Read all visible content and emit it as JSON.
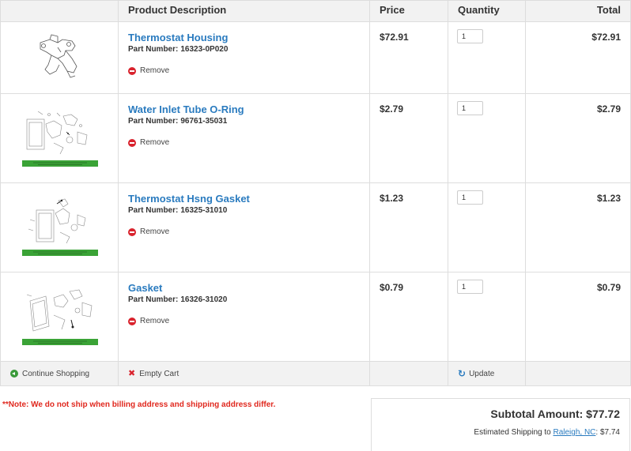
{
  "table": {
    "headers": {
      "image": "",
      "description": "Product Description",
      "price": "Price",
      "quantity": "Quantity",
      "total": "Total"
    },
    "part_label": "Part Number:",
    "remove_label": "Remove",
    "items": [
      {
        "name": "Thermostat Housing",
        "part_number": "16323-0P020",
        "price": "$72.91",
        "quantity": "1",
        "total": "$72.91",
        "thumb_icon": "thermostat-housing-diagram-icon"
      },
      {
        "name": "Water Inlet Tube O-Ring",
        "part_number": "96761-35031",
        "price": "$2.79",
        "quantity": "1",
        "total": "$2.79",
        "thumb_icon": "exploded-parts-diagram-icon"
      },
      {
        "name": "Thermostat Hsng Gasket",
        "part_number": "16325-31010",
        "price": "$1.23",
        "quantity": "1",
        "total": "$1.23",
        "thumb_icon": "exploded-parts-diagram-icon"
      },
      {
        "name": "Gasket",
        "part_number": "16326-31020",
        "price": "$0.79",
        "quantity": "1",
        "total": "$0.79",
        "thumb_icon": "exploded-parts-diagram-icon"
      }
    ],
    "footer": {
      "continue_label": "Continue Shopping",
      "empty_label": "Empty Cart",
      "update_label": "Update"
    }
  },
  "note": "**Note: We do not ship when billing address and shipping address differ.",
  "summary": {
    "subtotal": "Subtotal Amount: $77.72",
    "shipping_prefix": "Estimated Shipping to",
    "shipping_location": "Raleigh, NC",
    "shipping_amount": ": $7.74"
  },
  "colors": {
    "link": "#2a7bbf",
    "remove": "#d9232d",
    "note": "#e0281e",
    "continue": "#3a9a3a",
    "thumb_banner": "#3aa336"
  }
}
